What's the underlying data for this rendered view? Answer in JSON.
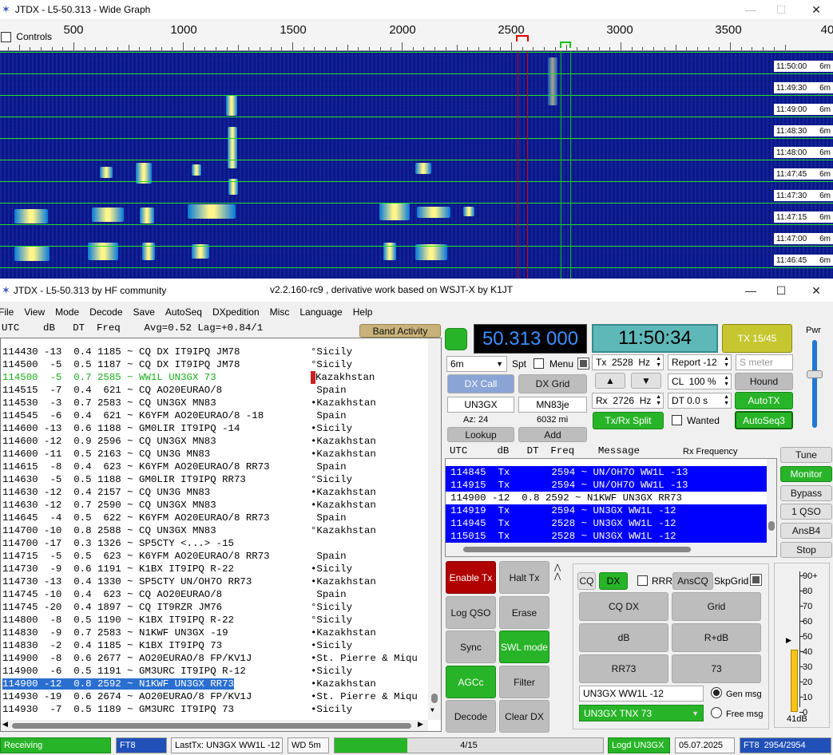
{
  "wide_graph": {
    "title": "JTDX - L5-50.313 - Wide Graph",
    "controls_label": "Controls",
    "ruler_labels": [
      "500",
      "1000",
      "1500",
      "2000",
      "2500",
      "3000",
      "3500",
      "40"
    ],
    "times": [
      "11:50:00",
      "11:49:30",
      "11:49:00",
      "11:48:30",
      "11:48:00",
      "11:47:45",
      "11:47:30",
      "11:47:15",
      "11:47:00",
      "11:46:45"
    ],
    "band": "6m"
  },
  "main": {
    "title": "JTDX - L5-50.313  by HF community",
    "subtitle": "v2.2.160-rc9 , derivative work based on WSJT-X by K1JT",
    "menu": [
      "File",
      "View",
      "Mode",
      "Decode",
      "Save",
      "AutoSeq",
      "DXpedition",
      "Misc",
      "Language",
      "Help"
    ]
  },
  "decode_pane": {
    "header": "UTC    dB   DT  Freq    Avg=0.52 Lag=+0.84/1",
    "band_activity_label": "Band Activity",
    "rows": [
      {
        "text": "114430 -13  0.4 1185 ~ CQ DX IT9IPQ JM78",
        "country": "°Sicily",
        "style": "normal"
      },
      {
        "text": "114500  -5  0.5 1187 ~ CQ DX IT9IPQ JM78",
        "country": "°Sicily",
        "style": "normal"
      },
      {
        "text": "114500  -5  0.7 2585 ~ WW1L UN3GX 73",
        "country": "Kazakhstan",
        "style": "green"
      },
      {
        "text": "114515  -7  0.4  621 ~ CQ AO20EURAO/8",
        "country": " Spain",
        "style": "normal"
      },
      {
        "text": "114530  -3  0.7 2583 ~ CQ UN3GX MN83",
        "country": "•Kazakhstan",
        "style": "normal"
      },
      {
        "text": "114545  -6  0.4  621 ~ K6YFM AO20EURAO/8 -18",
        "country": " Spain",
        "style": "normal"
      },
      {
        "text": "114600 -13  0.6 1188 ~ GM0LIR IT9IPQ -14",
        "country": "•Sicily",
        "style": "normal"
      },
      {
        "text": "114600 -12  0.9 2596 ~ CQ UN3GX MN83",
        "country": "•Kazakhstan",
        "style": "normal"
      },
      {
        "text": "114600 -11  0.5 2163 ~ CQ UN3G MN83",
        "country": "•Kazakhstan",
        "style": "normal"
      },
      {
        "text": "114615  -8  0.4  623 ~ K6YFM AO20EURAO/8 RR73",
        "country": " Spain",
        "style": "normal"
      },
      {
        "text": "114630  -5  0.5 1188 ~ GM0LIR IT9IPQ RR73",
        "country": "°Sicily",
        "style": "normal"
      },
      {
        "text": "114630 -12  0.4 2157 ~ CQ UN3G MN83",
        "country": "•Kazakhstan",
        "style": "normal"
      },
      {
        "text": "114630 -12  0.7 2590 ~ CQ UN3GX MN83",
        "country": "•Kazakhstan",
        "style": "normal"
      },
      {
        "text": "114645  -4  0.5  622 ~ K6YFM AO20EURAO/8 RR73",
        "country": " Spain",
        "style": "normal"
      },
      {
        "text": "114700 -10  0.8 2588 ~ CQ UN3GX MN83",
        "country": "°Kazakhstan",
        "style": "normal"
      },
      {
        "text": "114700 -17  0.3 1326 ~ SP5CTY <...> -15",
        "country": "",
        "style": "normal"
      },
      {
        "text": "114715  -5  0.5  623 ~ K6YFM AO20EURAO/8 RR73",
        "country": " Spain",
        "style": "normal"
      },
      {
        "text": "114730  -9  0.6 1191 ~ K1BX IT9IPQ R-22",
        "country": "•Sicily",
        "style": "normal"
      },
      {
        "text": "114730 -13  0.4 1330 ~ SP5CTY UN/OH7O RR73",
        "country": "•Kazakhstan",
        "style": "normal"
      },
      {
        "text": "114745 -10  0.4  623 ~ CQ AO20EURAO/8",
        "country": " Spain",
        "style": "normal"
      },
      {
        "text": "114745 -20  0.4 1897 ~ CQ IT9RZR JM76",
        "country": "°Sicily",
        "style": "normal"
      },
      {
        "text": "114800  -8  0.5 1190 ~ K1BX IT9IPQ R-22",
        "country": "°Sicily",
        "style": "normal"
      },
      {
        "text": "114830  -9  0.7 2583 ~ N1KWF UN3GX -19",
        "country": "•Kazakhstan",
        "style": "normal"
      },
      {
        "text": "114830  -2  0.4 1185 ~ K1BX IT9IPQ 73",
        "country": "•Sicily",
        "style": "normal"
      },
      {
        "text": "114900  -8  0.6 2677 ~ AO20EURAO/8 FP/KV1J",
        "country": "•St. Pierre & Miqu",
        "style": "normal"
      },
      {
        "text": "114900  -6  0.5 1191 ~ GM3URC IT9IPQ R-12",
        "country": "•Sicily",
        "style": "normal"
      },
      {
        "text": "114900 -12  0.8 2592 ~ N1KWF UN3GX RR73",
        "country": "•Kazakhstan",
        "style": "selected"
      },
      {
        "text": "114930 -19  0.6 2674 ~ AO20EURAO/8 FP/KV1J",
        "country": "•St. Pierre & Miqu",
        "style": "normal"
      },
      {
        "text": "114930  -7  0.5 1189 ~ GM3URC IT9IPQ 73",
        "country": "•Sicily",
        "style": "normal"
      }
    ]
  },
  "controls": {
    "frequency": "50.313 000",
    "clock": "11:50:34",
    "tx_period": "TX 15/45",
    "band": "6m",
    "spt_label": "Spt",
    "menu_label": "Menu",
    "dx_call_btn": "DX Call",
    "dx_grid_btn": "DX Grid",
    "dx_call": "UN3GX",
    "dx_grid": "MN83je",
    "az": "Az: 24",
    "dist": "6032 mi",
    "lookup": "Lookup",
    "add": "Add",
    "tx_freq": "Tx  2528  Hz",
    "rx_freq": "Rx  2726  Hz",
    "report": "Report -12",
    "s_meter": "S meter",
    "cl": "CL  100 %",
    "dt": "DT 0.0 s",
    "hound": "Hound",
    "autotx": "AutoTX",
    "autoseq3": "AutoSeq3",
    "txrx_split": "Tx/Rx Split",
    "wanted": "Wanted",
    "pwr": "Pwr"
  },
  "rx_pane": {
    "header": "UTC     dB   DT  Freq    Message",
    "rx_frequency": "Rx Frequency",
    "rows": [
      {
        "text": "114845  Tx       2594 ~ UN/OH7O WW1L -13",
        "tx": true
      },
      {
        "text": "114915  Tx       2594 ~ UN/OH7O WW1L -13",
        "tx": true
      },
      {
        "text": "114900 -12  0.8 2592 ~ N1KWF UN3GX RR73",
        "tx": false
      },
      {
        "text": "114919  Tx       2594 ~ UN3GX WW1L -12",
        "tx": true
      },
      {
        "text": "114945  Tx       2528 ~ UN3GX WW1L -12",
        "tx": true
      },
      {
        "text": "115015  Tx       2528 ~ UN3GX WW1L -12",
        "tx": true
      }
    ]
  },
  "side_buttons": [
    "Tune",
    "Monitor",
    "Bypass",
    "1 QSO",
    "AnsB4",
    "Stop"
  ],
  "left_buttons": [
    "Enable Tx",
    "Halt Tx",
    "Log QSO",
    "Erase",
    "Sync",
    "SWL mode",
    "AGCc",
    "Filter",
    "Decode",
    "Clear DX"
  ],
  "tx_panel": {
    "cq": "CQ",
    "dx": "DX",
    "rrr": "RRR",
    "anscq": "AnsCQ",
    "skpgrid": "SkpGrid",
    "cq_dx": "CQ DX",
    "grid": "Grid",
    "db": "dB",
    "r_db": "R+dB",
    "rr73": "RR73",
    "seventy_three": "73",
    "gen_msg_text": "UN3GX WW1L -12",
    "gen_msg": "Gen msg",
    "free_msg_text": "UN3GX TNX 73",
    "free_msg": "Free msg"
  },
  "meter": {
    "labels": [
      "90+",
      "80",
      "70",
      "60",
      "50",
      "40",
      "30",
      "20",
      "10",
      "0"
    ],
    "value_label": "41dB",
    "level": 41
  },
  "status": {
    "receiving": "Receiving",
    "mode": "FT8",
    "last_tx": "LastTx: UN3GX WW1L -12",
    "wd": "WD 5m",
    "progress": "4/15",
    "progress_frac": 0.27,
    "logd": "Logd UN3GX",
    "date": "05.07.2025",
    "ft8_count": "FT8  2954/2954"
  }
}
